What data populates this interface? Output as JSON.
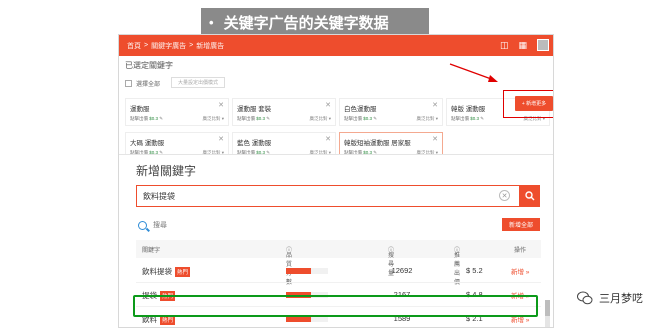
{
  "slide": {
    "bullet": "•",
    "title": "关键字广告的关键字数据"
  },
  "app": {
    "breadcrumb": [
      "首頁",
      "關鍵字廣告",
      "新增廣告"
    ],
    "breadcrumb_sep": ">",
    "icons": [
      "bell-icon",
      "grid-icon",
      "avatar"
    ],
    "colors": {
      "accent": "#ee4d2d",
      "highlight_green": "#0c9a1a",
      "annotation_red": "#e00000"
    }
  },
  "selected": {
    "title": "已選定關鍵字",
    "select_all_label": "選擇全部",
    "bulk_button_label": "大量設定出價模式",
    "add_more_label": "+ 新增更多",
    "cards": [
      {
        "name": "運動服",
        "price_label": "點擊出價",
        "price": "$0.3",
        "match": "廣泛比對"
      },
      {
        "name": "運動服 套裝",
        "price_label": "點擊出價",
        "price": "$0.3",
        "match": "廣泛比對"
      },
      {
        "name": "白色運動服",
        "price_label": "點擊出價",
        "price": "$0.3",
        "match": "廣泛比對"
      },
      {
        "name": "韓版 運動服",
        "price_label": "點擊出價",
        "price": "$0.3",
        "match": "廣泛比對"
      },
      {
        "name": "大碼 運動服",
        "price_label": "點擊出價",
        "price": "$0.3",
        "match": "廣泛比對"
      },
      {
        "name": "藍色 運動服",
        "price_label": "點擊出價",
        "price": "$0.3",
        "match": "廣泛比對"
      },
      {
        "name": "韓版短袖運動服 居家服",
        "price_label": "點擊出價",
        "price": "$0.3",
        "match": "廣泛比對"
      }
    ]
  },
  "add_keyword": {
    "title": "新增關鍵字",
    "search_value": "飲料提袋",
    "hint": "搜尋",
    "add_all_label": "新增全部",
    "columns": [
      "關鍵字",
      "品質分數",
      "搜尋量",
      "推薦出價",
      "操作"
    ],
    "rows": [
      {
        "keyword": "飲料提袋",
        "tag": "熱門",
        "quality": 0.6,
        "volume": "12692",
        "price": "$ 5.2",
        "action": "新增 »"
      },
      {
        "keyword": "提袋",
        "tag": "熱門",
        "quality": 0.6,
        "volume": "2167",
        "price": "$ 4.8",
        "action": "新增 »"
      },
      {
        "keyword": "飲料",
        "tag": "熱門",
        "quality": 0.6,
        "volume": "1589",
        "price": "$ 2.1",
        "action": "新增 »"
      }
    ]
  },
  "watermark": {
    "text": "三月梦呓"
  }
}
